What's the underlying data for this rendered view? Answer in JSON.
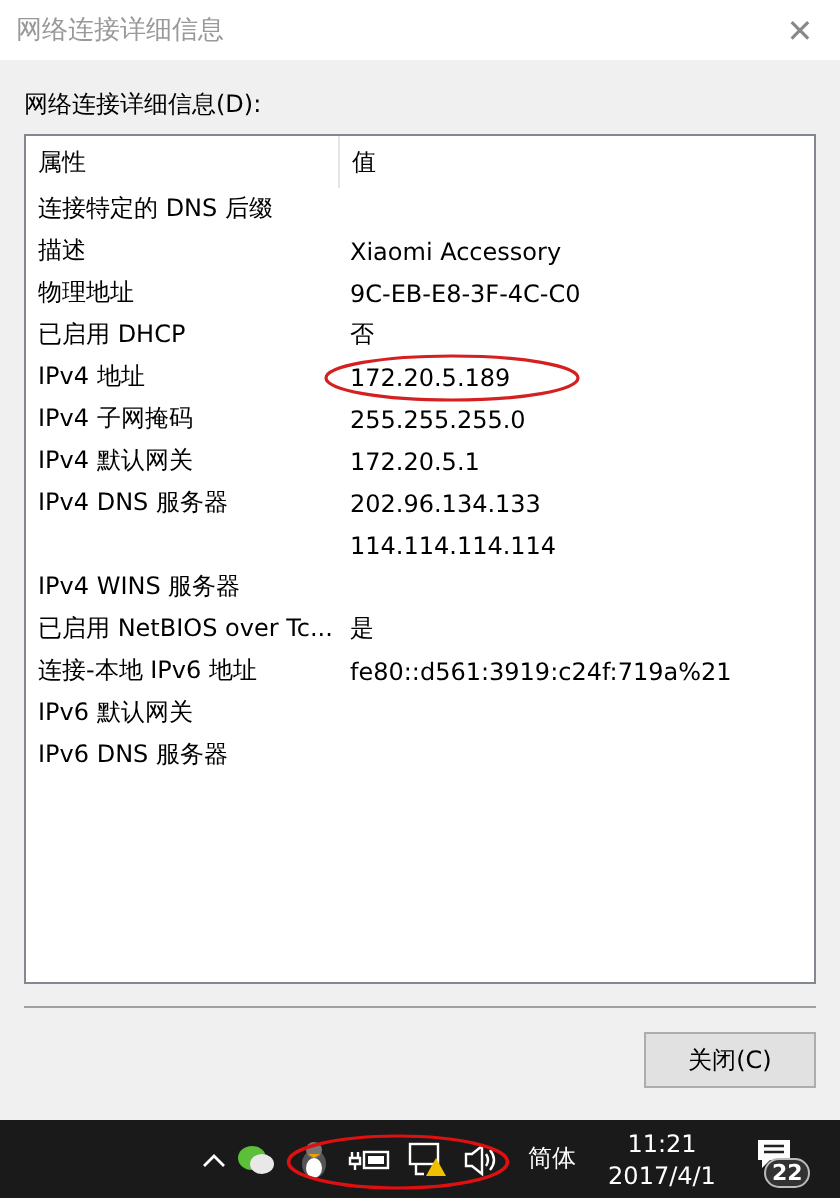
{
  "window": {
    "title": "网络连接详细信息",
    "close": "✕"
  },
  "label": "网络连接详细信息(D):",
  "table": {
    "columns": [
      "属性",
      "值"
    ],
    "rows": [
      {
        "property": "连接特定的 DNS 后缀"
      },
      {
        "property": "描述",
        "value": "Xiaomi Accessory"
      },
      {
        "property": "物理地址",
        "value": "9C-EB-E8-3F-4C-C0"
      },
      {
        "property": "已启用 DHCP",
        "value": "否"
      },
      {
        "property": "IPv4 地址",
        "value": "172.20.5.189",
        "circled": true
      },
      {
        "property": "IPv4 子网掩码",
        "value": "255.255.255.0"
      },
      {
        "property": "IPv4 默认网关",
        "value": "172.20.5.1"
      },
      {
        "property": "IPv4 DNS 服务器",
        "value": "202.96.134.133"
      },
      {
        "value": "114.114.114.114"
      },
      {
        "property": "IPv4 WINS 服务器"
      },
      {
        "property": "已启用 NetBIOS over Tc...",
        "value": "是"
      },
      {
        "property": "连接-本地 IPv6 地址",
        "value": "fe80::d561:3919:c24f:719a%21"
      },
      {
        "property": "IPv6 默认网关"
      },
      {
        "property": "IPv6 DNS 服务器"
      }
    ]
  },
  "buttons": [
    "关闭(C)"
  ],
  "taskbar": {
    "input_method": "简体",
    "time": "11:21",
    "date": "2017/4/1",
    "notifications": "22"
  }
}
